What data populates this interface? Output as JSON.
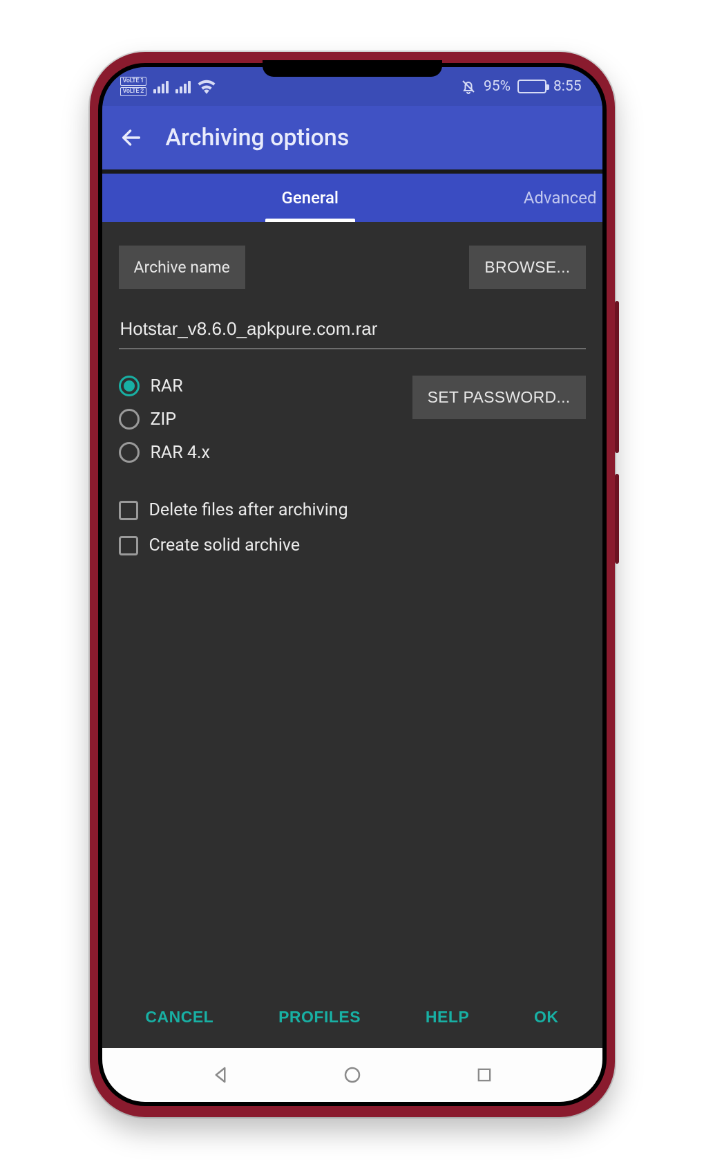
{
  "status": {
    "volte1": "VoLTE 1",
    "volte2": "VoLTE 2",
    "battery_pct": "95%",
    "time": "8:55"
  },
  "appbar": {
    "title": "Archiving options"
  },
  "tabs": {
    "general": "General",
    "advanced": "Advanced"
  },
  "archive": {
    "name_label": "Archive name",
    "browse_label": "BROWSE...",
    "name_value": "Hotstar_v8.6.0_apkpure.com.rar",
    "set_password_label": "SET PASSWORD..."
  },
  "formats": {
    "rar": "RAR",
    "zip": "ZIP",
    "rar4": "RAR 4.x",
    "selected": "rar"
  },
  "options": {
    "delete_after": "Delete files after archiving",
    "solid_archive": "Create solid archive"
  },
  "footer": {
    "cancel": "CANCEL",
    "profiles": "PROFILES",
    "help": "HELP",
    "ok": "OK"
  }
}
